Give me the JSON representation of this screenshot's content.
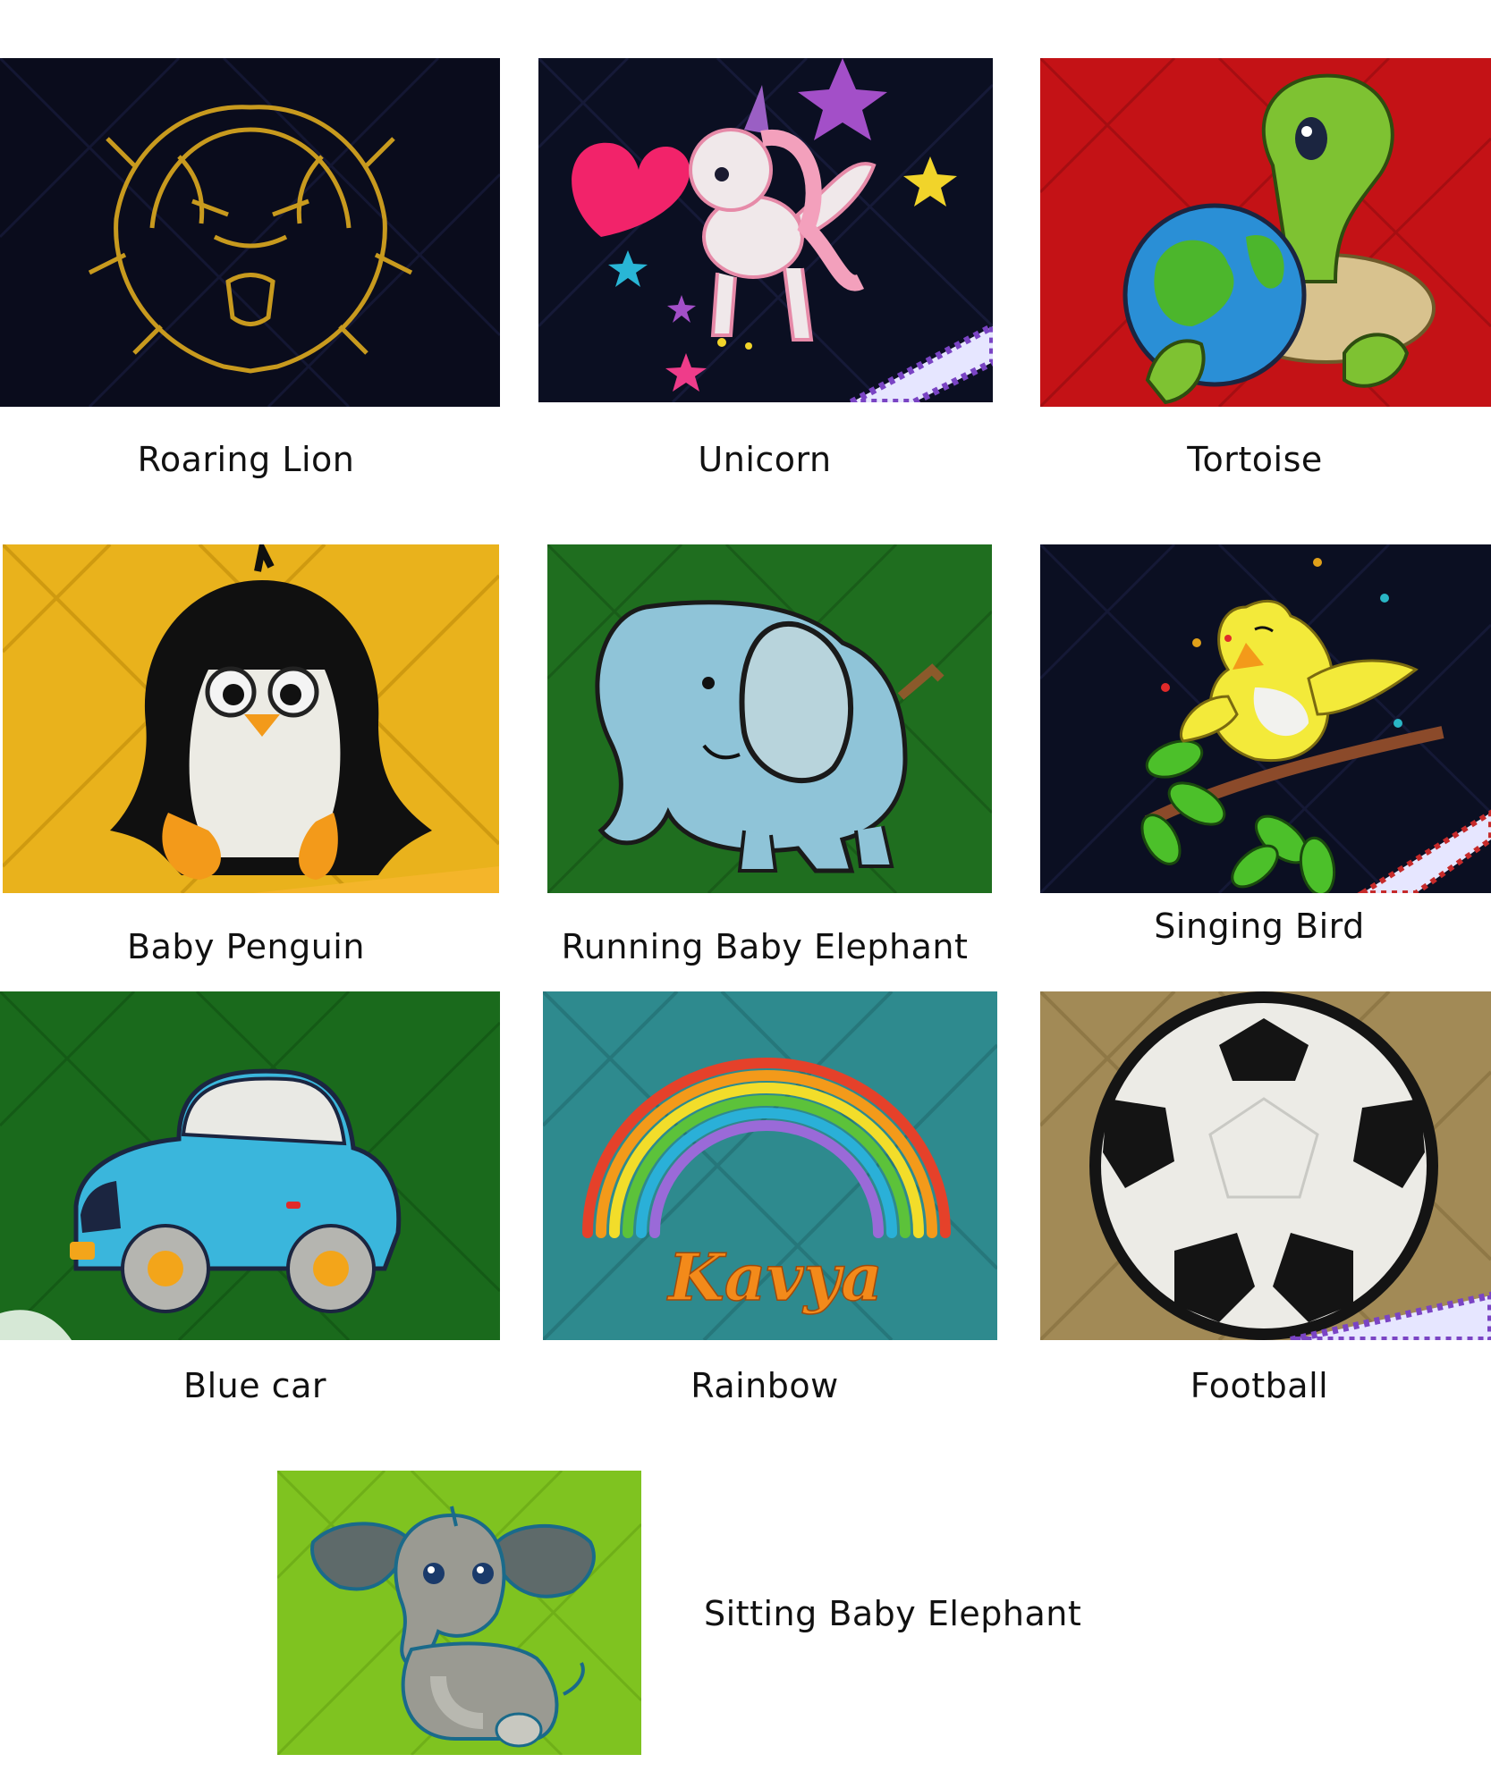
{
  "designs": [
    {
      "id": "lion",
      "label": "Roaring Lion",
      "fabric": "#0a0c1c",
      "icon": "lion-icon"
    },
    {
      "id": "unicorn",
      "label": "Unicorn",
      "fabric": "#0b0f22",
      "icon": "unicorn-icon"
    },
    {
      "id": "tortoise",
      "label": "Tortoise",
      "fabric": "#c41216",
      "icon": "tortoise-icon"
    },
    {
      "id": "penguin",
      "label": "Baby Penguin",
      "fabric": "#e9b21c",
      "icon": "penguin-icon"
    },
    {
      "id": "running-elephant",
      "label": "Running Baby Elephant",
      "fabric": "#1f6e1f",
      "icon": "elephant-icon"
    },
    {
      "id": "singing-bird",
      "label": "Singing Bird",
      "fabric": "#0b0f22",
      "icon": "bird-icon"
    },
    {
      "id": "blue-car",
      "label": "Blue car",
      "fabric": "#1a6a1c",
      "icon": "car-icon"
    },
    {
      "id": "rainbow",
      "label": "Rainbow",
      "fabric": "#2e8a8e",
      "icon": "rainbow-icon",
      "embroidered_name": "Kavya"
    },
    {
      "id": "football",
      "label": "Football",
      "fabric": "#a28a56",
      "icon": "football-icon"
    },
    {
      "id": "sitting-elephant",
      "label": "Sitting Baby Elephant",
      "fabric": "#7fc320",
      "icon": "sitting-elephant-icon"
    }
  ]
}
